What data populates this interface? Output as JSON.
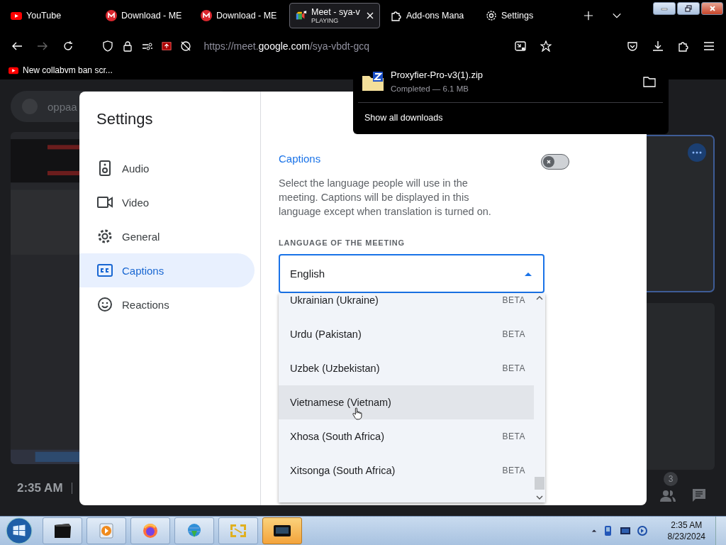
{
  "browser": {
    "tabs": [
      {
        "title": "YouTube",
        "selected": false
      },
      {
        "title": "Download - ME",
        "selected": false
      },
      {
        "title": "Download - ME",
        "selected": false
      },
      {
        "title": "Meet - sya-v",
        "subtitle": "PLAYING",
        "selected": true
      },
      {
        "title": "Add-ons Mana",
        "selected": false
      },
      {
        "title": "Settings",
        "selected": false
      }
    ],
    "url": "https://meet.**google.com**/sya-vbdt-gcq",
    "bookmarks": [
      {
        "title": "New collabvm ban scr..."
      }
    ]
  },
  "downloads": {
    "items": [
      {
        "name": "Proxyfier-Pro-v3(1).zip",
        "status": "Completed — 6.1 MB"
      }
    ],
    "show_all": "Show all downloads"
  },
  "meeting": {
    "search_text": "oppaa",
    "time": "2:35 AM",
    "participants_count": "3"
  },
  "settings": {
    "title": "Settings",
    "nav": [
      {
        "label": "Audio",
        "selected": false
      },
      {
        "label": "Video",
        "selected": false
      },
      {
        "label": "General",
        "selected": false
      },
      {
        "label": "Captions",
        "selected": true
      },
      {
        "label": "Reactions",
        "selected": false
      }
    ],
    "section_title": "Captions",
    "captions_on": false,
    "description": "Select the language people will use in the meeting. Captions will be displayed in this language except when translation is turned on.",
    "language_label": "LANGUAGE OF THE MEETING",
    "language_value": "English",
    "dropdown_open": true,
    "options": [
      {
        "label": "Ukrainian (Ukraine)",
        "badge": "BETA",
        "hovered": false
      },
      {
        "label": "Urdu (Pakistan)",
        "badge": "BETA",
        "hovered": false
      },
      {
        "label": "Uzbek (Uzbekistan)",
        "badge": "BETA",
        "hovered": false
      },
      {
        "label": "Vietnamese (Vietnam)",
        "hovered": true
      },
      {
        "label": "Xhosa (South Africa)",
        "badge": "BETA",
        "hovered": false
      },
      {
        "label": "Xitsonga (South Africa)",
        "badge": "BETA",
        "hovered": false
      }
    ]
  },
  "taskbar": {
    "apps": [
      {
        "active": false
      },
      {
        "active": false
      },
      {
        "active": false
      },
      {
        "active": false
      },
      {
        "active": false
      },
      {
        "active": true
      }
    ],
    "time": "2:35 AM",
    "date": "8/23/2024"
  }
}
